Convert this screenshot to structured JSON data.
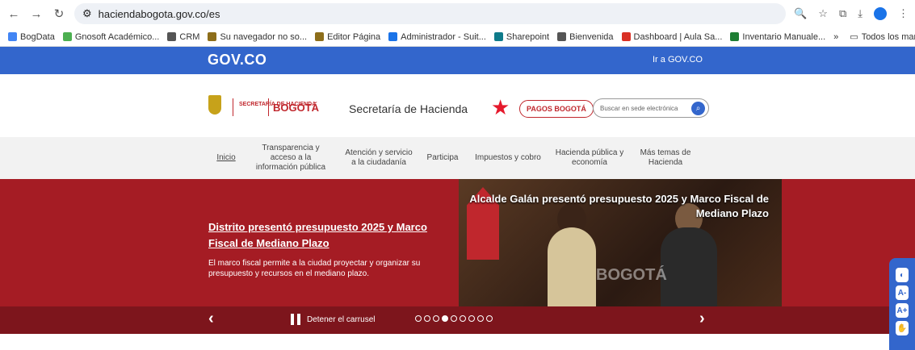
{
  "browser": {
    "url": "haciendabogota.gov.co/es",
    "bookmarks": [
      "BogData",
      "Gnosoft Académico...",
      "CRM",
      "Su navegador no so...",
      "Editor Página",
      "Administrador - Suit...",
      "Sharepoint",
      "Bienvenida",
      "Dashboard | Aula Sa...",
      "Inventario Manuale..."
    ],
    "bookmark_colors": [
      "#4285f4",
      "#4caf50",
      "#555555",
      "#8d6e1a",
      "#8d6e1a",
      "#1a73e8",
      "#0f7b8a",
      "#555555",
      "#d93025",
      "#1e7e34"
    ],
    "overflow": "»",
    "all_bookmarks": "Todos los marcadores"
  },
  "gov": {
    "logo": "GOV.CO",
    "link": "Ir a GOV.CO"
  },
  "header": {
    "hacienda_logo": "SECRETARÍA DE HACIENDA",
    "bogota_logo": "BOGOTÁ",
    "title": "Secretaría de Hacienda",
    "pagos_button": "PAGOS BOGOTÁ",
    "search_placeholder": "Buscar en sede electrónica"
  },
  "menu": {
    "items": [
      "Inicio",
      "Transparencia y acceso a la información pública",
      "Atención y servicio a la ciudadanía",
      "Participa",
      "Impuestos y cobro",
      "Hacienda pública y economía",
      "Más temas de Hacienda"
    ]
  },
  "slide": {
    "title": "Distrito presentó presupuesto 2025 y Marco Fiscal de Mediano Plazo",
    "description": "El marco fiscal permite a la ciudad proyectar y organizar su presupuesto y recursos en el mediano plazo.",
    "image_caption": "Alcalde Galán presentó presupuesto 2025 y Marco Fiscal de Mediano Plazo",
    "sign_text": "BOGOTÁ"
  },
  "carousel": {
    "pause_label": "Detener el carrusel",
    "total_slides": 9,
    "active_slide": 4
  },
  "colors": {
    "gov_blue": "#3366cc",
    "hacienda_red": "#a51c24",
    "control_bar": "#7d151c"
  }
}
